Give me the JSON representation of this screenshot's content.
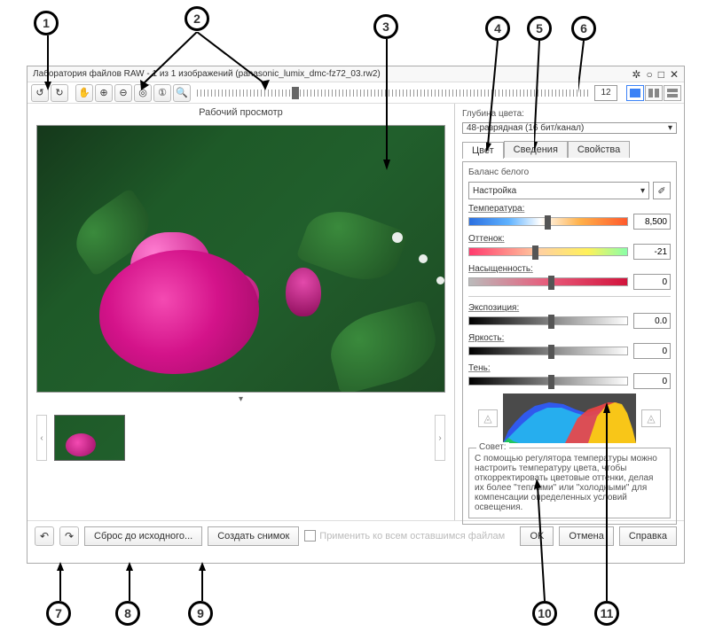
{
  "callouts": [
    "1",
    "2",
    "3",
    "4",
    "5",
    "6",
    "7",
    "8",
    "9",
    "10",
    "11"
  ],
  "window": {
    "title": "Лаборатория файлов RAW - 1 из 1 изображений (panasonic_lumix_dmc-fz72_03.rw2)"
  },
  "toolbar": {
    "zoom_value": "12"
  },
  "preview": {
    "label": "Рабочий просмотр"
  },
  "rightpane": {
    "depth_label": "Глубина цвета:",
    "depth_value": "48-разрядная (16 бит/канал)",
    "tabs": {
      "color": "Цвет",
      "details": "Сведения",
      "properties": "Свойства"
    },
    "wb": {
      "group": "Баланс белого",
      "preset": "Настройка"
    },
    "params": {
      "temperature": {
        "label": "Температура:",
        "value": "8,500"
      },
      "tint": {
        "label": "Оттенок:",
        "value": "-21"
      },
      "saturation": {
        "label": "Насыщенность:",
        "value": "0"
      },
      "exposure": {
        "label": "Экспозиция:",
        "value": "0.0"
      },
      "brightness": {
        "label": "Яркость:",
        "value": "0"
      },
      "shadow": {
        "label": "Тень:",
        "value": "0"
      }
    },
    "tip": {
      "title": "Совет:",
      "body": "С помощью регулятора температуры можно настроить температуру цвета, чтобы откорректировать цветовые оттенки, делая их более \"теплыми\" или \"холодными\" для компенсации определенных условий освещения."
    }
  },
  "bottom": {
    "reset": "Сброс до исходного...",
    "snapshot": "Создать снимок",
    "apply_rest": "Применить ко всем оставшимся файлам",
    "ok": "OK",
    "cancel": "Отмена",
    "help": "Справка"
  }
}
